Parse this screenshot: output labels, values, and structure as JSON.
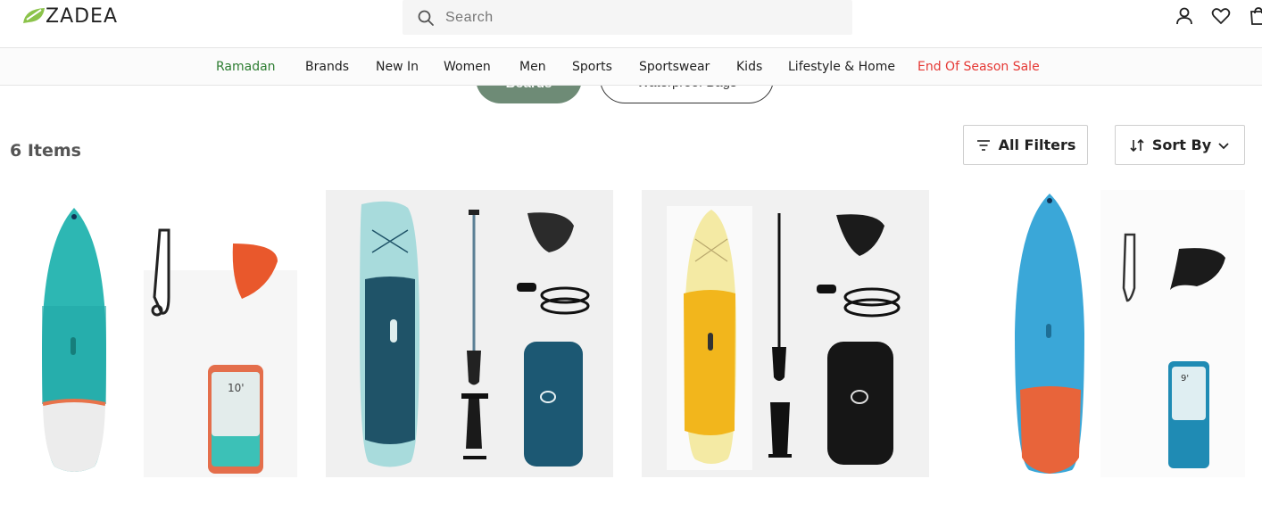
{
  "brand": {
    "name": "ZADEA"
  },
  "search": {
    "placeholder": "Search"
  },
  "header_icons": [
    "user-icon",
    "heart-icon",
    "cart-icon"
  ],
  "nav": {
    "items": [
      {
        "label": "Ramadan",
        "color": "#2e7d32"
      },
      {
        "label": "Brands",
        "color": "#222222"
      },
      {
        "label": "New In",
        "color": "#222222"
      },
      {
        "label": "Women",
        "color": "#222222"
      },
      {
        "label": "Men",
        "color": "#222222"
      },
      {
        "label": "Sports",
        "color": "#222222"
      },
      {
        "label": "Sportswear",
        "color": "#222222"
      },
      {
        "label": "Kids",
        "color": "#222222"
      },
      {
        "label": "Lifestyle & Home",
        "color": "#222222"
      },
      {
        "label": "End Of Season Sale",
        "color": "#e53935"
      }
    ]
  },
  "category_pills": [
    {
      "label": "Boards",
      "active": true
    },
    {
      "label": "Waterproof Bags",
      "active": false
    }
  ],
  "results": {
    "count_label": "6 Items"
  },
  "toolbar": {
    "filters_label": "All Filters",
    "sort_label": "Sort By"
  },
  "products": [
    {
      "board_color": "teal",
      "accent": "#e8734a"
    },
    {
      "board_color": "pale-aqua",
      "accent": "#215a70"
    },
    {
      "board_color": "yellow",
      "accent": "#f2b61c"
    },
    {
      "board_color": "sky-blue",
      "accent": "#e8643a"
    }
  ],
  "colors": {
    "accent_green": "#6e8b76",
    "ramadan_green": "#2e7d32",
    "sale_red": "#e53935"
  }
}
